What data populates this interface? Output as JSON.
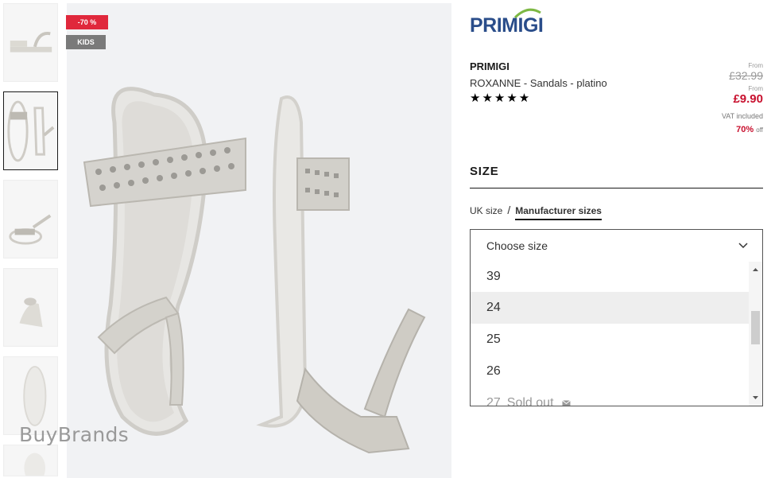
{
  "badges": {
    "discount": "-70 %",
    "category": "KIDS"
  },
  "watermark": "BuyBrands",
  "brand_logo": "PRIMIGI",
  "product": {
    "brand": "PRIMIGI",
    "name": "ROXANNE - Sandals - platino",
    "rating_stars": "★★★★★"
  },
  "price": {
    "from_label_1": "From",
    "original": "£32.99",
    "from_label_2": "From",
    "current": "£9.90",
    "vat": "VAT included",
    "discount_pct": "70%",
    "discount_word": "off"
  },
  "size": {
    "title": "SIZE",
    "uk_label": "UK size",
    "separator": "/",
    "manufacturer_label": "Manufacturer sizes",
    "placeholder": "Choose size",
    "options": [
      {
        "label": "39"
      },
      {
        "label": "24"
      },
      {
        "label": "25"
      },
      {
        "label": "26"
      },
      {
        "label": "27",
        "status": "Sold out"
      }
    ]
  },
  "icons": [
    "chevron-down-icon",
    "envelope-icon",
    "scroll-up-icon",
    "scroll-down-icon"
  ],
  "colors": {
    "sale_red": "#c8102e",
    "badge_red": "#e0283c",
    "badge_grey": "#7a7a7a",
    "logo_blue": "#2a4d8a"
  }
}
